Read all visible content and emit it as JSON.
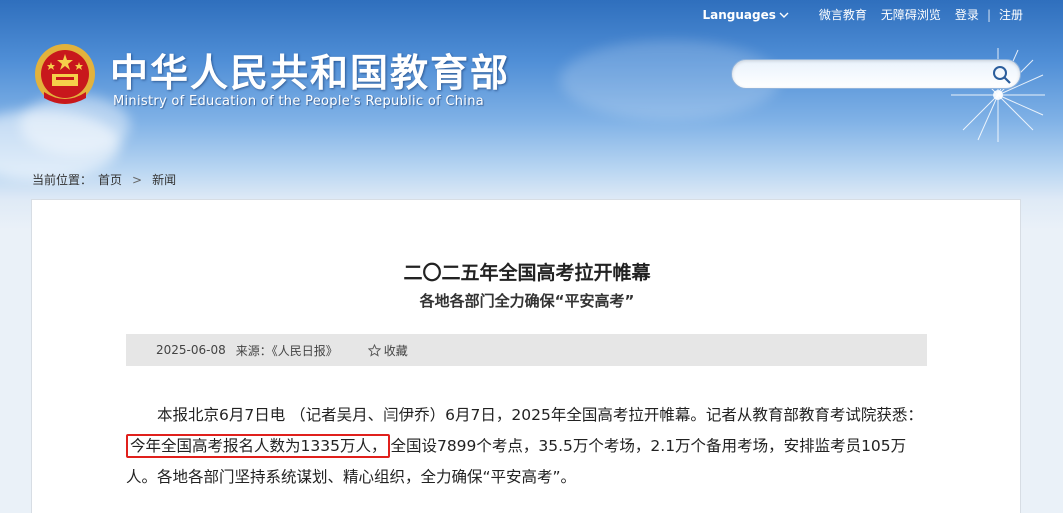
{
  "topbar": {
    "languages": "Languages",
    "weibo": "微言教育",
    "accessible": "无障碍浏览",
    "login": "登录",
    "divider": "|",
    "register": "注册"
  },
  "header": {
    "title": "中华人民共和国教育部",
    "subtitle": "Ministry of Education of the People's Republic of China"
  },
  "search": {
    "value": "",
    "placeholder": ""
  },
  "breadcrumb": {
    "label": "当前位置：",
    "home": "首页",
    "separator": ">",
    "current": "新闻"
  },
  "article": {
    "title": "二〇二五年全国高考拉开帷幕",
    "subtitle": "各地各部门全力确保“平安高考”",
    "date": "2025-06-08",
    "source": "来源：《人民日报》",
    "favorite": "收藏",
    "body_before": "本报北京6月7日电 （记者吴月、闫伊乔）6月7日，2025年全国高考拉开帷幕。记者从教育部教育考试院获悉：",
    "body_highlight": "今年全国高考报名人数为1335万人，",
    "body_after": "全国设7899个考点，35.5万个考场，2.1万个备用考场，安排监考员105万人。各地各部门坚持系统谋划、精心组织，全力确保“平安高考”。"
  },
  "colors": {
    "highlight_border": "#e0201c",
    "meta_bar": "#e6e6e6"
  }
}
